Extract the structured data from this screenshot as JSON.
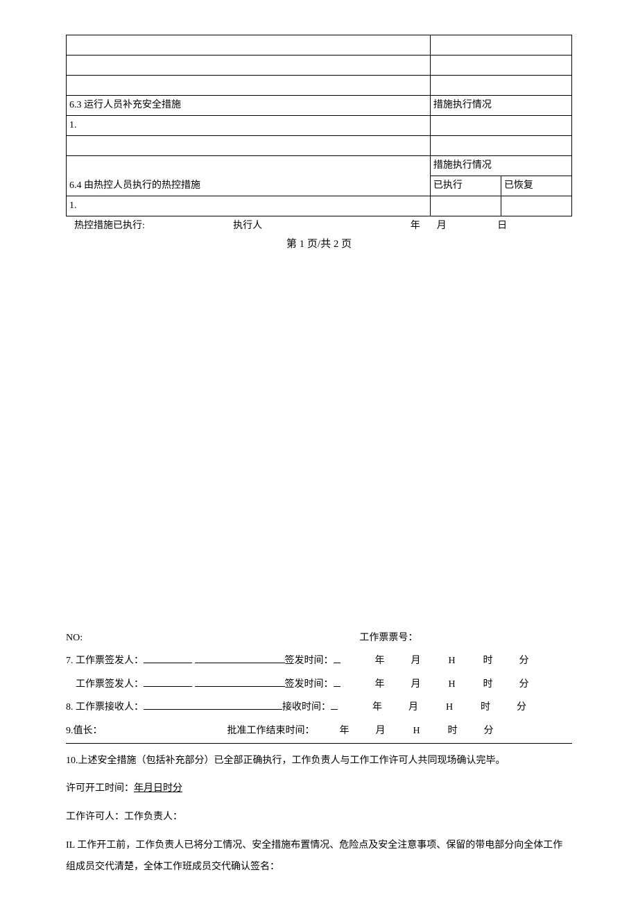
{
  "table": {
    "s63_title": "6.3 运行人员补充安全措施",
    "s63_status": "措施执行情况",
    "s63_item1": "1.",
    "s64_title": "6.4 由热控人员执行的热控措施",
    "s64_status": "措施执行情况",
    "s64_col1": "已执行",
    "s64_col2": "已恢复",
    "s64_item1": "1."
  },
  "exec": {
    "prefix": "热控措施已执行:",
    "person": "执行人",
    "year": "年",
    "month": "月",
    "day": "日"
  },
  "pageno": "第 1 页/共 2 页",
  "lower": {
    "no_label": "NO:",
    "ticket_label": "工作票票号：",
    "l7a": "7. 工作票签发人：",
    "l7b": "工作票签发人：",
    "l8": "8. 工作票接收人：",
    "sign_time": "签发时间：",
    "recv_time": "接收时间：",
    "l9a": "9.值长：",
    "l9b": "批准工作结束时间：",
    "y": "年",
    "m": "月",
    "H": "H",
    "hr": "时",
    "mn": "分",
    "l10": "10.上述安全措施（包括补充部分）已全部正确执行，工作负责人与工作工作许可人共同现场确认完毕。",
    "l10b_label": "许可开工时间：",
    "l10b_value": "年月日时分",
    "l10c": "工作许可人：工作负责人：",
    "l11": "IL 工作开工前，工作负责人已将分工情况、安全措施布置情况、危险点及安全注意事项、保留的带电部分向全体工作组成员交代清楚，全体工作班成员交代确认签名："
  }
}
